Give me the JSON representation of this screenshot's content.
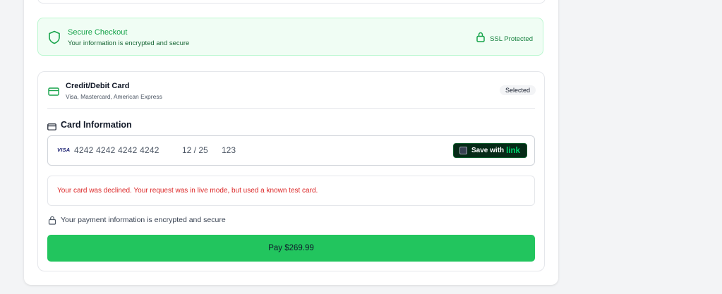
{
  "secure_banner": {
    "title": "Secure Checkout",
    "subtitle": "Your information is encrypted and secure",
    "ssl_label": "SSL Protected",
    "icons": [
      "shield-icon",
      "lock-icon"
    ]
  },
  "payment_method": {
    "title": "Credit/Debit Card",
    "subtitle": "Visa, Mastercard, American Express",
    "badge": "Selected",
    "icon": "credit-card-icon"
  },
  "card_info": {
    "heading": "Card Information",
    "brand": "VISA",
    "number": "4242 4242 4242 4242",
    "expiry": "12 / 25",
    "cvc": "123",
    "save_label": "Save with",
    "save_brand": "link",
    "save_checked": false
  },
  "error": {
    "message": "Your card was declined. Your request was in live mode, but used a known test card."
  },
  "encryption_note": "Your payment information is encrypted and secure",
  "pay_button": {
    "label": "Pay $269.99"
  },
  "colors": {
    "accent_green": "#22c55e",
    "banner_bg": "#f0fdf4",
    "error_red": "#dc2626",
    "link_brand": "#00d66f"
  }
}
